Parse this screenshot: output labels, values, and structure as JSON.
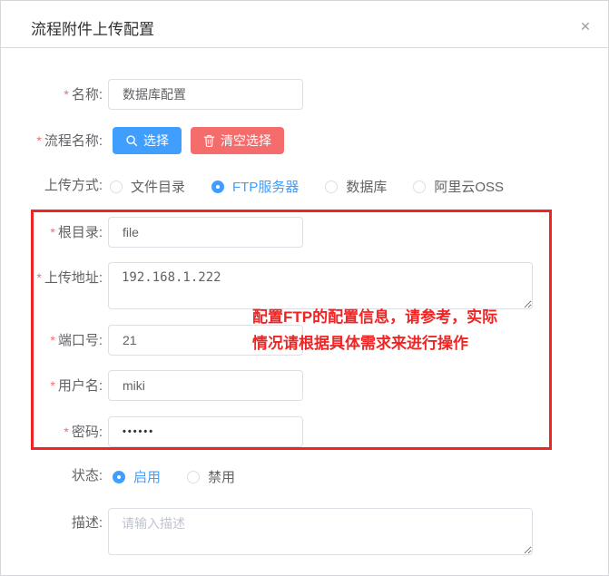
{
  "dialog": {
    "title": "流程附件上传配置",
    "close_glyph": "✕"
  },
  "form": {
    "required_mark": "*",
    "name": {
      "label": "名称:",
      "required": true,
      "value": "数据库配置"
    },
    "process_name": {
      "label": "流程名称:",
      "required": true,
      "select_button": "选择",
      "clear_button": "清空选择"
    },
    "upload_mode": {
      "label": "上传方式:",
      "required": false,
      "options": [
        {
          "label": "文件目录",
          "selected": false
        },
        {
          "label": "FTP服务器",
          "selected": true
        },
        {
          "label": "数据库",
          "selected": false
        },
        {
          "label": "阿里云OSS",
          "selected": false
        }
      ]
    },
    "root_dir": {
      "label": "根目录:",
      "required": true,
      "value": "file"
    },
    "upload_addr": {
      "label": "上传地址:",
      "required": true,
      "value": "192.168.1.222"
    },
    "port": {
      "label": "端口号:",
      "required": true,
      "value": "21"
    },
    "username": {
      "label": "用户名:",
      "required": true,
      "value": "miki"
    },
    "password": {
      "label": "密码:",
      "required": true,
      "value": "••••••"
    },
    "status": {
      "label": "状态:",
      "required": false,
      "options": [
        {
          "label": "启用",
          "selected": true
        },
        {
          "label": "禁用",
          "selected": false
        }
      ]
    },
    "description": {
      "label": "描述:",
      "required": false,
      "value": "",
      "placeholder": "请输入描述"
    }
  },
  "annotation": {
    "line1": "配置FTP的配置信息，请参考，实际",
    "line2": "情况请根据具体需求来进行操作"
  },
  "colors": {
    "primary_blue": "#409EFF",
    "danger_red": "#F56C6C",
    "annotation_red": "#F12424",
    "input_border": "#DCDFE6",
    "label_text": "#606266",
    "title_text": "#303133"
  }
}
